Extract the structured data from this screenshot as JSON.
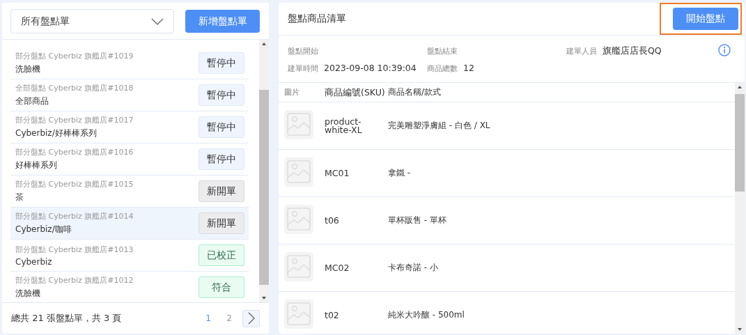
{
  "left_panel": {
    "filter_dropdown": {
      "value": "所有盤點單"
    },
    "new_button": "新增盤點單",
    "orders": [
      {
        "meta": "部分盤點 Cyberbiz 旗艦店#1019",
        "name": "洗臉機",
        "status": "暫停中",
        "kind": "paused",
        "selected": false
      },
      {
        "meta": "全部盤點 Cyberbiz 旗艦店#1018",
        "name": "全部商品",
        "status": "暫停中",
        "kind": "paused",
        "selected": false
      },
      {
        "meta": "部分盤點 Cyberbiz 旗艦店#1017",
        "name": "Cyberbiz/好棒棒系列",
        "status": "暫停中",
        "kind": "paused",
        "selected": false
      },
      {
        "meta": "部分盤點 Cyberbiz 旗艦店#1016",
        "name": "好棒棒系列",
        "status": "暫停中",
        "kind": "paused",
        "selected": false
      },
      {
        "meta": "部分盤點 Cyberbiz 旗艦店#1015",
        "name": "茶",
        "status": "新開單",
        "kind": "new",
        "selected": false
      },
      {
        "meta": "部分盤點 Cyberbiz 旗艦店#1014",
        "name": "Cyberbiz/咖啡",
        "status": "新開單",
        "kind": "new",
        "selected": true
      },
      {
        "meta": "部分盤點 Cyberbiz 旗艦店#1013",
        "name": "Cyberbiz",
        "status": "已校正",
        "kind": "done",
        "selected": false
      },
      {
        "meta": "部分盤點 Cyberbiz 旗艦店#1012",
        "name": "洗臉機",
        "status": "符合",
        "kind": "done",
        "selected": false
      }
    ],
    "footer": {
      "summary": "總共 21 張盤點單，共 3 頁",
      "pages": [
        {
          "label": "1",
          "selected": true
        },
        {
          "label": "2",
          "selected": false
        }
      ]
    }
  },
  "right_panel": {
    "title": "盤點商品清單",
    "start_button": {
      "label": "開始盤點",
      "highlighted": true
    },
    "info": [
      {
        "label": "盤點開始"
      },
      {
        "label": "盤點結束"
      },
      {
        "label": "建單人員",
        "value": "旗艦店店長QQ"
      },
      {
        "label": "建單時間",
        "value": "2023-09-08 10:39:04"
      },
      {
        "label": "商品總數",
        "value": "12"
      }
    ],
    "table": {
      "columns": [
        "圖片",
        "商品編號(SKU)",
        "商品名稱/款式"
      ],
      "rows": [
        {
          "sku": "product-white-XL",
          "name": "完美雕塑淨膚組 - 白色 / XL"
        },
        {
          "sku": "MC01",
          "name": "拿鐵 -"
        },
        {
          "sku": "t06",
          "name": "單杯販售 - 單杯"
        },
        {
          "sku": "MC02",
          "name": "卡布奇諾 - 小"
        },
        {
          "sku": "t02",
          "name": "純米大吟釀 - 500ml"
        }
      ]
    }
  }
}
